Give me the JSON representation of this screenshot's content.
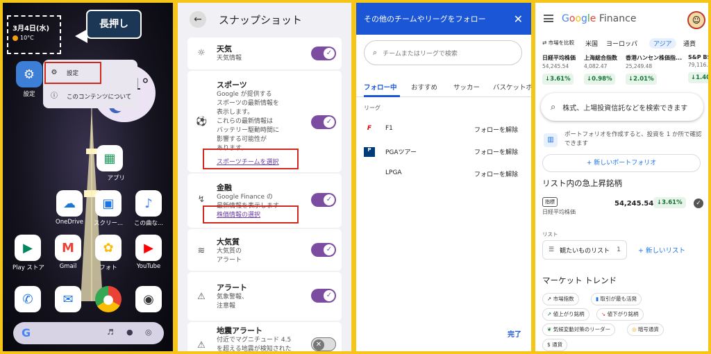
{
  "panel1": {
    "date": "3月4日(水)",
    "temperature": "10°C",
    "callout": "長押し",
    "settings_label": "設定",
    "menu": {
      "item1": "設定",
      "item2": "このコンテンツについて"
    },
    "clock_partial": "-1°",
    "apps_row0": {
      "apps": "アプリ"
    },
    "apps_row1": [
      {
        "label": "OneDrive"
      },
      {
        "label": "スクリー..."
      },
      {
        "label": "この曲な..."
      }
    ],
    "apps_row2": [
      {
        "label": "Play ストア"
      },
      {
        "label": "Gmail"
      },
      {
        "label": "フォト"
      },
      {
        "label": "YouTube"
      }
    ],
    "search_g": "G"
  },
  "panel2": {
    "title": "スナップショット",
    "rows": [
      {
        "title": "天気",
        "sub": "天気情報"
      },
      {
        "title": "スポーツ",
        "sub": "Google が提供する\nスポーツの最新情報を\n表示します。\nこれらの最新情報は\nバッテリー駆動時間に\n影響する可能性が\nあります。",
        "link": "スポーツチームを選択"
      },
      {
        "title": "金融",
        "sub": "Google Finance の\n最新情報を表示します",
        "link": "株価情報の選択"
      },
      {
        "title": "大気質",
        "sub": "大気質の\nアラート"
      },
      {
        "title": "アラート",
        "sub": "気象警報、\n注意報"
      },
      {
        "title": "地震アラート",
        "sub": "付近でマグニチュード 4.5\nを超える地震が検知された"
      }
    ]
  },
  "panel3": {
    "title": "その他のチームやリーグをフォロー",
    "search_placeholder": "チームまたはリーグで検索",
    "tabs": [
      "フォロー中",
      "おすすめ",
      "サッカー",
      "バスケットボ"
    ],
    "section": "リーグ",
    "leagues": [
      {
        "name": "F1",
        "action": "フォローを解除"
      },
      {
        "name": "PGAツアー",
        "action": "フォローを解除"
      },
      {
        "name": "LPGA",
        "action": "フォローを解除"
      }
    ],
    "done": "完了"
  },
  "panel4": {
    "logo": {
      "g": "Go",
      "o": "o",
      "g2": "g",
      "l": "l",
      "e": "e",
      "finance": " Finance"
    },
    "market_tabs": [
      "市場を比較",
      "米国",
      "ヨーロッパ",
      "アジア",
      "通貨"
    ],
    "indices": [
      {
        "name": "日経平均株価",
        "value": "54,245.54",
        "change": "↓3.61%"
      },
      {
        "name": "上海総合指数",
        "value": "4,082.47",
        "change": "↓0.98%"
      },
      {
        "name": "香港ハンセン株価指...",
        "value": "25,249.48",
        "change": "↓2.01%"
      },
      {
        "name": "S&P BS",
        "value": "79,116.",
        "change": "↓1.40"
      }
    ],
    "search_placeholder": "株式、上場投資信託などを検索できます",
    "portfolio_text": "ポートフォリオを作成すると、投資を 1 か所で確認できます",
    "new_portfolio": "+ 新しいポートフォリオ",
    "movers_title": "リスト内の急上昇銘柄",
    "mover": {
      "tag": "指標",
      "name": "日経平均株価",
      "value": "54,245.54",
      "change": "↓3.61%"
    },
    "list_label": "リスト",
    "watchlist": "観たいものリスト",
    "watchlist_count": "1",
    "new_list": "+ 新しいリスト",
    "trends_title": "マーケット トレンド",
    "chips": [
      "市場指数",
      "取引が最も活発",
      "値上がり銘柄",
      "値下がり銘柄",
      "気候変動対策のリーダー",
      "暗号通貨",
      "通貨"
    ]
  }
}
